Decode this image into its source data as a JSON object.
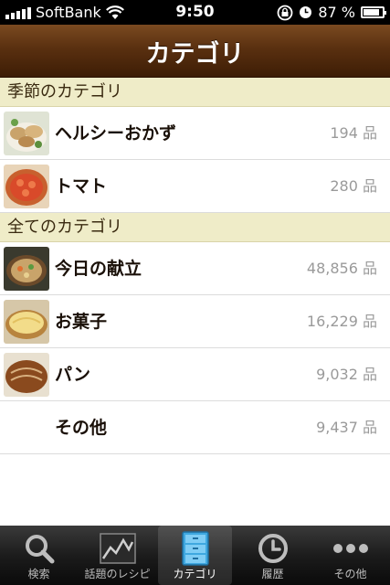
{
  "status": {
    "carrier": "SoftBank",
    "time": "9:50",
    "battery_percent": "87 %",
    "battery_level": 0.87
  },
  "navbar": {
    "title": "カテゴリ"
  },
  "sections": [
    {
      "header": "季節のカテゴリ",
      "rows": [
        {
          "label": "ヘルシーおかず",
          "count": "194 品",
          "thumb": "healthy-dish-thumbnail"
        },
        {
          "label": "トマト",
          "count": "280 品",
          "thumb": "tomato-tart-thumbnail"
        }
      ]
    },
    {
      "header": "全てのカテゴリ",
      "rows": [
        {
          "label": "今日の献立",
          "count": "48,856 品",
          "thumb": "soup-thumbnail"
        },
        {
          "label": "お菓子",
          "count": "16,229 品",
          "thumb": "pie-thumbnail"
        },
        {
          "label": "パン",
          "count": "9,032 品",
          "thumb": "bread-thumbnail"
        },
        {
          "label": "その他",
          "count": "9,437 品",
          "thumb": ""
        }
      ]
    }
  ],
  "tabbar": {
    "tabs": [
      {
        "label": "検索",
        "icon": "search-icon"
      },
      {
        "label": "話題のレシピ",
        "icon": "trending-chart-icon"
      },
      {
        "label": "カテゴリ",
        "icon": "cabinet-icon",
        "selected": true
      },
      {
        "label": "履歴",
        "icon": "clock-icon"
      },
      {
        "label": "その他",
        "icon": "more-dots-icon"
      }
    ]
  },
  "colors": {
    "navbar": "#5a3010",
    "section_header_bg": "#efecc8",
    "count_text": "#9a9a9a"
  }
}
